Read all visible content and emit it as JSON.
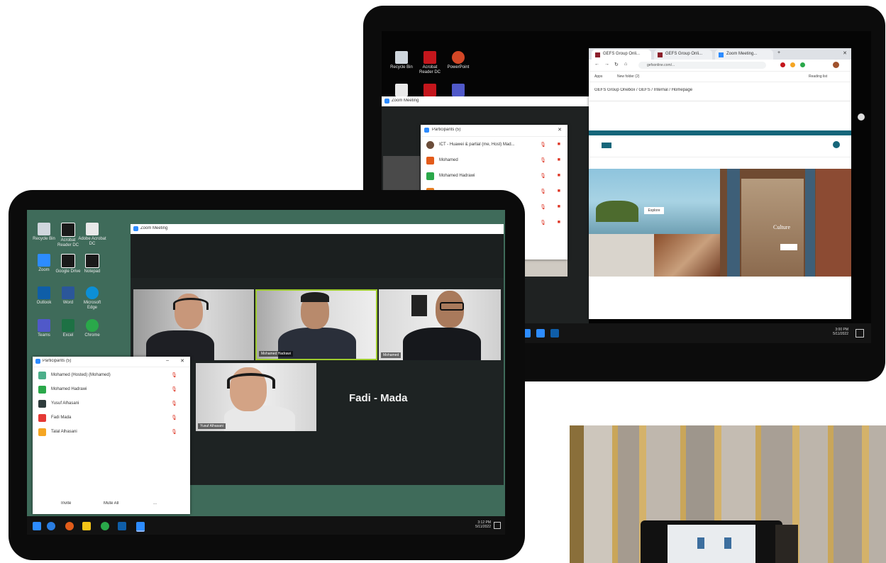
{
  "back_monitor": {
    "desktop_icons": [
      {
        "label": "Recycle Bin",
        "icon": "recycle-bin-icon",
        "color": "#cfd6dd"
      },
      {
        "label": "Acrobat Reader DC",
        "icon": "acrobat-icon",
        "color": "#c4161c"
      },
      {
        "label": "PowerPoint",
        "icon": "powerpoint-icon",
        "color": "#d24726"
      }
    ],
    "zoom_window_title": "Zoom Meeting",
    "browser": {
      "tabs": [
        "GEFS Group Onli...",
        "GEFS Group Onli...",
        "Zoom Meeting..."
      ],
      "url": "gefsonline.com/...",
      "bookmarks": [
        "Apps",
        "New folder (2)",
        "Reading list"
      ],
      "breadcrumb": "GEFS Group Onebox / GEFS / Internal / Homepage",
      "hero_button": "Explore",
      "hero_caption": "Culture"
    },
    "participants_window": {
      "title": "Participants (5)",
      "rows": [
        {
          "name": "ICT - Huawei & partial (me, Host) Mad...",
          "color": "#6b4d3a"
        },
        {
          "name": "Mohamed",
          "color": "#e35b1a"
        },
        {
          "name": "Mohamed Hadrawi",
          "color": "#2aa84a"
        },
        {
          "name": "...",
          "color": "#e67e22"
        },
        {
          "name": "...",
          "color": "#e67e22"
        },
        {
          "name": "...",
          "color": "#e67e22"
        }
      ]
    }
  },
  "front_tablet": {
    "desktop_icons": [
      {
        "label": "Recycle Bin",
        "icon": "recycle-bin-icon",
        "color": "#cfd6dd"
      },
      {
        "label": "Acrobat Reader DC",
        "icon": "acrobat-icon",
        "color": "#1a1a1a"
      },
      {
        "label": "Adobe Acrobat DC",
        "icon": "adobe-icon",
        "color": "#e8e8e8"
      },
      {
        "label": "Zoom",
        "icon": "zoom-icon",
        "color": "#2d8cff"
      },
      {
        "label": "Google Drive",
        "icon": "drive-icon",
        "color": "#1a1a1a"
      },
      {
        "label": "Notepad",
        "icon": "notepad-icon",
        "color": "#1a1a1a"
      },
      {
        "label": "Outlook",
        "icon": "outlook-icon",
        "color": "#0f5ea8"
      },
      {
        "label": "Word",
        "icon": "word-icon",
        "color": "#2b579a"
      },
      {
        "label": "Microsoft Edge",
        "icon": "edge-icon",
        "color": "#0c8fd6"
      },
      {
        "label": "Teams",
        "icon": "teams-icon",
        "color": "#5059c9"
      },
      {
        "label": "Excel",
        "icon": "excel-icon",
        "color": "#1d7144"
      },
      {
        "label": "Chrome",
        "icon": "chrome-icon",
        "color": "#2aa84a"
      }
    ],
    "zoom_window_title": "Zoom Meeting",
    "tiles": [
      {
        "name": "",
        "label_key": "t1"
      },
      {
        "name": "Mohamed Hadrawi",
        "label_key": "t2"
      },
      {
        "name": "Mohamed",
        "label_key": "t3"
      },
      {
        "name": "Yusuf Alhasani",
        "label_key": "t4"
      }
    ],
    "active_speaker_name": "Fadi - Mada",
    "participants_window": {
      "title": "Participants (5)",
      "rows": [
        {
          "name": "Mohamed (Hosted) (Mohamed)",
          "color": "#4caf8a"
        },
        {
          "name": "Mohamed Hadrawi",
          "color": "#2aa84a"
        },
        {
          "name": "Yusuf Alhasani",
          "color": "#2e3b3b"
        },
        {
          "name": "Fadi Mada",
          "color": "#e53935"
        },
        {
          "name": "Talal Alhasani",
          "color": "#f5a623"
        }
      ],
      "footer_buttons": [
        "Invite",
        "Mute All",
        "..."
      ]
    },
    "taskbar": {
      "clock_time": "3:12 PM",
      "clock_date": "5/11/2022"
    }
  },
  "back_taskbar": {
    "clock_time": "3:00 PM",
    "clock_date": "5/11/2022"
  }
}
